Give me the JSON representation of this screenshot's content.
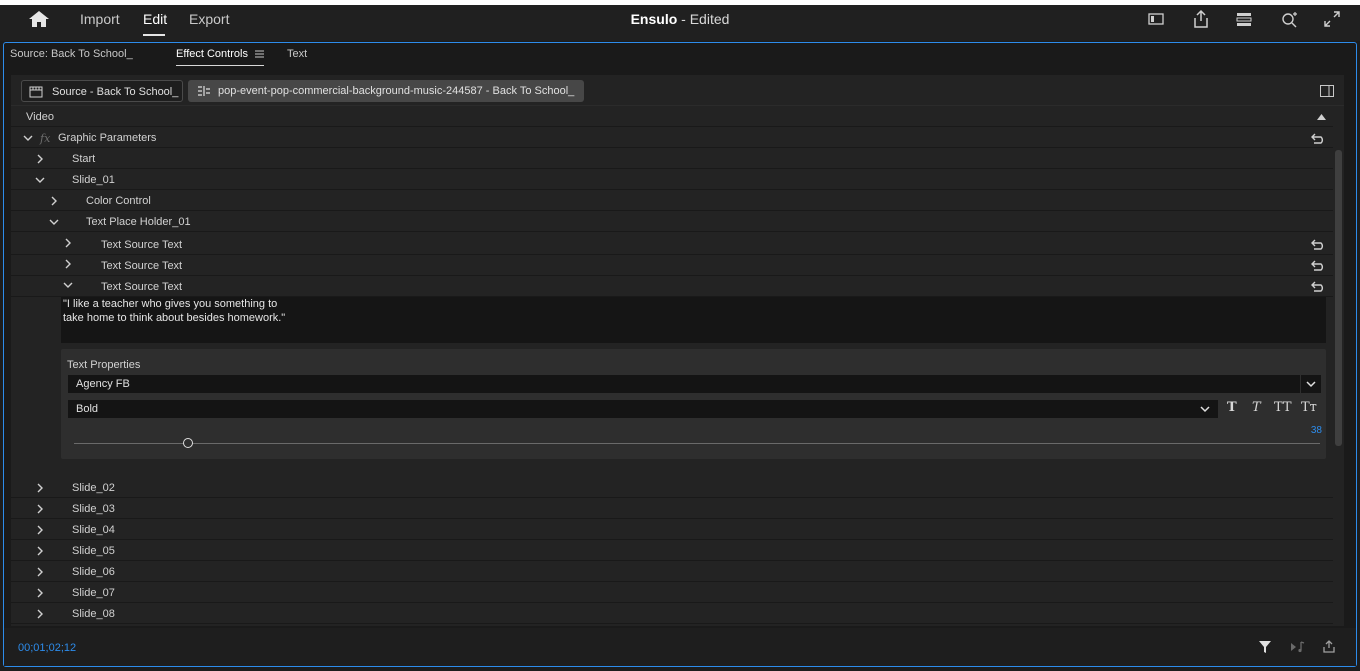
{
  "topbar": {
    "menu": [
      "Import",
      "Edit",
      "Export"
    ],
    "active_menu": "Edit",
    "project_name": "Ensulo",
    "project_status": "- Edited"
  },
  "panel": {
    "tabs": [
      "Source: Back To School_",
      "Effect Controls",
      "Text"
    ],
    "active_tab": "Effect Controls",
    "clip_tabs": [
      "Source - Back To School_",
      "pop-event-pop-commercial-background-music-244587 - Back To School_"
    ],
    "section": "Video",
    "effect": "Graphic Parameters",
    "rows": {
      "start": "Start",
      "slide_01": "Slide_01",
      "color_control": "Color Control",
      "placeholder": "Text Place Holder_01",
      "source_text_1": "Text Source Text",
      "source_text_2": "Text Source Text",
      "source_text_3": "Text Source Text"
    },
    "quote": [
      "\"I like a teacher who gives you something to",
      "take home to think about besides homework.\""
    ],
    "text_properties": {
      "title": "Text Properties",
      "font": "Agency FB",
      "style": "Bold",
      "size": "38",
      "format_buttons": [
        "T",
        "T",
        "TT",
        "Tт"
      ]
    },
    "slides": [
      "Slide_02",
      "Slide_03",
      "Slide_04",
      "Slide_05",
      "Slide_06",
      "Slide_07",
      "Slide_08"
    ]
  },
  "footer": {
    "timecode": "00;01;02;12"
  },
  "colors": {
    "accent": "#2d8ceb",
    "background": "#1d1d1d"
  }
}
